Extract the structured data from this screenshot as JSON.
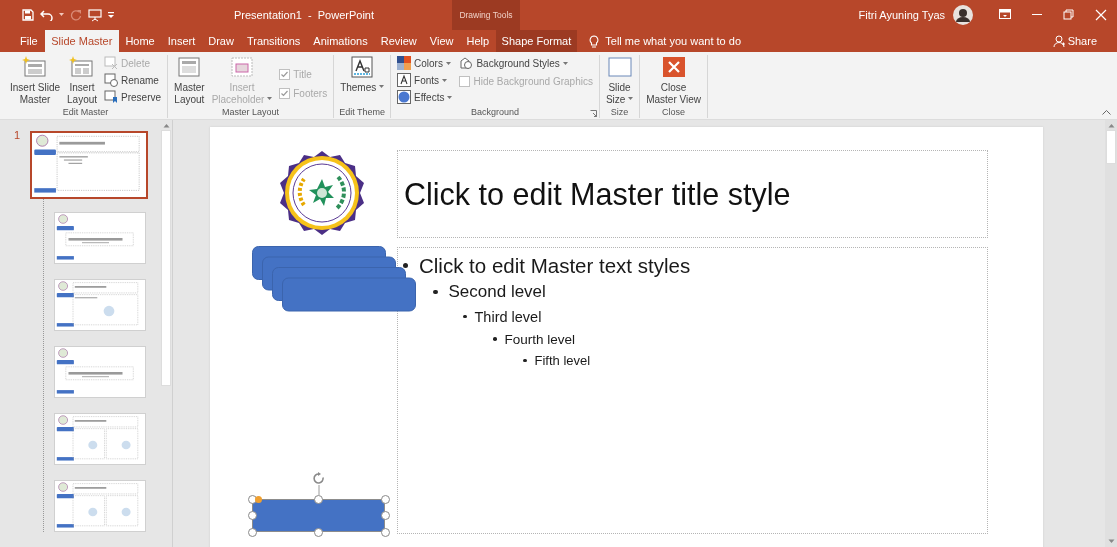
{
  "title_bar": {
    "title": "Presentation1  -  PowerPoint",
    "context_label": "Drawing Tools",
    "user": "Fitri Ayuning Tyas"
  },
  "tabs": [
    {
      "label": "File",
      "selected": false,
      "kind": "normal"
    },
    {
      "label": "Slide Master",
      "selected": true,
      "kind": "normal"
    },
    {
      "label": "Home",
      "selected": false,
      "kind": "normal"
    },
    {
      "label": "Insert",
      "selected": false,
      "kind": "normal"
    },
    {
      "label": "Draw",
      "selected": false,
      "kind": "normal"
    },
    {
      "label": "Transitions",
      "selected": false,
      "kind": "normal"
    },
    {
      "label": "Animations",
      "selected": false,
      "kind": "normal"
    },
    {
      "label": "Review",
      "selected": false,
      "kind": "normal"
    },
    {
      "label": "View",
      "selected": false,
      "kind": "normal"
    },
    {
      "label": "Help",
      "selected": false,
      "kind": "normal"
    },
    {
      "label": "Shape Format",
      "selected": false,
      "kind": "contextual"
    }
  ],
  "tell_me": {
    "placeholder": "Tell me what you want to do"
  },
  "share": "Share",
  "ribbon": {
    "groups": [
      {
        "label": "Edit Master",
        "launcher": false,
        "columns": [
          [
            {
              "kind": "large",
              "lines": [
                "Insert Slide",
                "Master"
              ],
              "disabled": false,
              "dropdown": false
            }
          ],
          [
            {
              "kind": "large",
              "lines": [
                "Insert",
                "Layout"
              ],
              "disabled": false,
              "dropdown": false
            }
          ],
          [
            {
              "kind": "small",
              "label": "Delete",
              "disabled": true,
              "dropdown": false
            },
            {
              "kind": "small",
              "label": "Rename",
              "disabled": false,
              "dropdown": false
            },
            {
              "kind": "small",
              "label": "Preserve",
              "disabled": false,
              "dropdown": false
            }
          ]
        ]
      },
      {
        "label": "Master Layout",
        "launcher": false,
        "columns": [
          [
            {
              "kind": "large",
              "lines": [
                "Master",
                "Layout"
              ],
              "disabled": false,
              "dropdown": false
            }
          ],
          [
            {
              "kind": "large",
              "lines": [
                "Insert",
                "Placeholder"
              ],
              "disabled": true,
              "dropdown": true
            }
          ],
          [
            {
              "kind": "check",
              "label": "Title",
              "disabled": true,
              "checked": true
            },
            {
              "kind": "check",
              "label": "Footers",
              "disabled": true,
              "checked": true
            }
          ]
        ]
      },
      {
        "label": "Edit Theme",
        "launcher": false,
        "columns": [
          [
            {
              "kind": "large",
              "lines": [
                "Themes"
              ],
              "disabled": false,
              "dropdown": true
            }
          ]
        ]
      },
      {
        "label": "Background",
        "launcher": true,
        "columns": [
          [
            {
              "kind": "small",
              "label": "Colors",
              "disabled": false,
              "dropdown": true
            },
            {
              "kind": "small",
              "label": "Fonts",
              "disabled": false,
              "dropdown": true
            },
            {
              "kind": "small",
              "label": "Effects",
              "disabled": false,
              "dropdown": true
            }
          ],
          [
            {
              "kind": "small",
              "label": "Background Styles",
              "disabled": false,
              "dropdown": true
            },
            {
              "kind": "check",
              "label": "Hide Background Graphics",
              "disabled": true,
              "checked": false
            }
          ]
        ]
      },
      {
        "label": "Size",
        "launcher": false,
        "columns": [
          [
            {
              "kind": "large",
              "lines": [
                "Slide",
                "Size"
              ],
              "disabled": false,
              "dropdown": true
            }
          ]
        ]
      },
      {
        "label": "Close",
        "launcher": false,
        "columns": [
          [
            {
              "kind": "large",
              "lines": [
                "Close",
                "Master View"
              ],
              "disabled": false,
              "dropdown": false
            }
          ]
        ]
      }
    ]
  },
  "thumbnails": [
    {
      "number": "1",
      "kind": "master",
      "selected": true
    },
    {
      "kind": "title",
      "selected": false
    },
    {
      "kind": "content",
      "selected": false
    },
    {
      "kind": "title",
      "selected": false
    },
    {
      "kind": "two",
      "selected": false
    },
    {
      "kind": "two",
      "selected": false
    }
  ],
  "slide": {
    "title": "Click to edit Master title style",
    "body": [
      {
        "text": "Click to edit Master text styles",
        "children": [
          {
            "text": "Second level",
            "children": [
              {
                "text": "Third level",
                "children": [
                  {
                    "text": "Fourth level",
                    "children": [
                      {
                        "text": "Fifth level"
                      }
                    ]
                  }
                ]
              }
            ]
          }
        ]
      }
    ],
    "shapes": [
      {
        "kind": "rect",
        "selected": true
      }
    ]
  }
}
